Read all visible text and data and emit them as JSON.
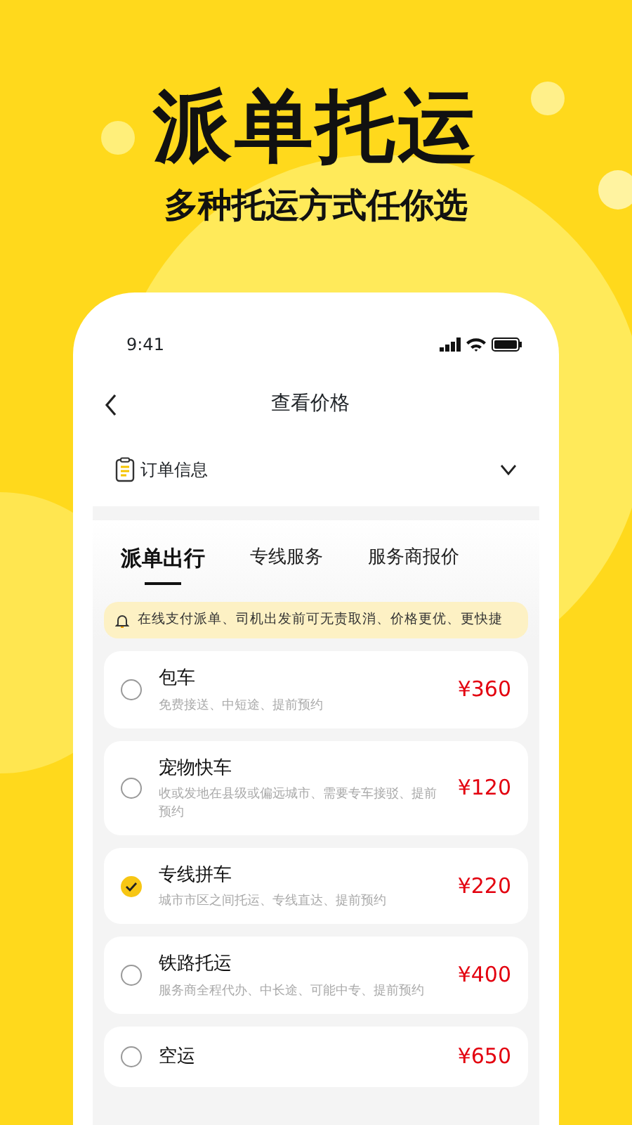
{
  "headline": "派单托运",
  "subheadline": "多种托运方式任你选",
  "phone": {
    "status_bar": {
      "time": "9:41"
    },
    "header": {
      "title": "查看价格"
    },
    "order_info": {
      "label": "订单信息",
      "expanded": false
    },
    "tabs": [
      {
        "label": "派单出行",
        "selected": true
      },
      {
        "label": "专线服务",
        "selected": false
      },
      {
        "label": "服务商报价",
        "selected": false
      }
    ],
    "notice": "在线支付派单、司机出发前可无责取消、价格更优、更快捷",
    "options": [
      {
        "title": "包车",
        "description": "免费接送、中短途、提前预约",
        "price": "¥360",
        "selected": false
      },
      {
        "title": "宠物快车",
        "description": "收或发地在县级或偏远城市、需要专车接驳、提前预约",
        "price": "¥120",
        "selected": false
      },
      {
        "title": "专线拼车",
        "description": "城市市区之间托运、专线直达、提前预约",
        "price": "¥220",
        "selected": true
      },
      {
        "title": "铁路托运",
        "description": "服务商全程代办、中长途、可能中专、提前预约",
        "price": "¥400",
        "selected": false
      },
      {
        "title": "空运",
        "price": "¥650",
        "selected": false
      }
    ]
  }
}
